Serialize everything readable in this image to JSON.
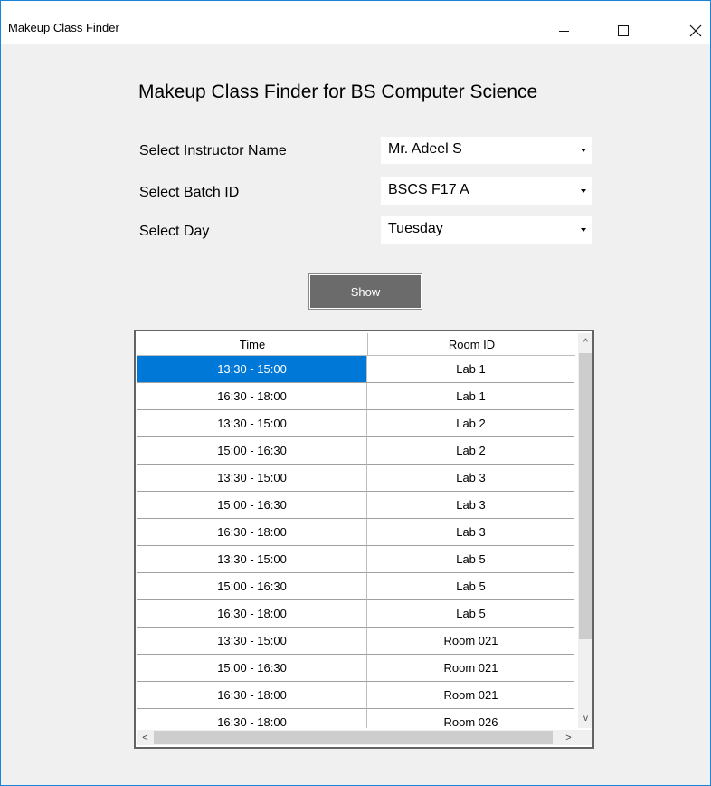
{
  "window": {
    "title": "Makeup Class Finder",
    "minimize_glyph": "—",
    "maximize_glyph": "☐",
    "close_glyph": "✕"
  },
  "form": {
    "heading": "Makeup Class Finder for BS Computer Science",
    "instructor_label": "Select Instructor Name",
    "instructor_value": "Mr. Adeel S",
    "batch_label": "Select Batch ID",
    "batch_value": "BSCS F17 A",
    "day_label": "Select Day",
    "day_value": "Tuesday",
    "show_button": "Show"
  },
  "grid": {
    "columns": [
      "Time",
      "Room ID"
    ],
    "rows": [
      {
        "time": "13:30 - 15:00",
        "room": "Lab 1",
        "selected": true
      },
      {
        "time": "16:30 - 18:00",
        "room": "Lab 1"
      },
      {
        "time": "13:30 - 15:00",
        "room": "Lab 2"
      },
      {
        "time": "15:00 - 16:30",
        "room": "Lab 2"
      },
      {
        "time": "13:30 - 15:00",
        "room": "Lab 3"
      },
      {
        "time": "15:00 - 16:30",
        "room": "Lab 3"
      },
      {
        "time": "16:30 - 18:00",
        "room": "Lab 3"
      },
      {
        "time": "13:30 - 15:00",
        "room": "Lab 5"
      },
      {
        "time": "15:00 - 16:30",
        "room": "Lab 5"
      },
      {
        "time": "16:30 - 18:00",
        "room": "Lab 5"
      },
      {
        "time": "13:30 - 15:00",
        "room": "Room 021"
      },
      {
        "time": "15:00 - 16:30",
        "room": "Room 021"
      },
      {
        "time": "16:30 - 18:00",
        "room": "Room 021"
      },
      {
        "time": "16:30 - 18:00",
        "room": "Room 026"
      }
    ],
    "selection_color": "#0078d7"
  },
  "scrollbars": {
    "up_glyph": "^",
    "down_glyph": "v",
    "left_glyph": "<",
    "right_glyph": ">"
  }
}
